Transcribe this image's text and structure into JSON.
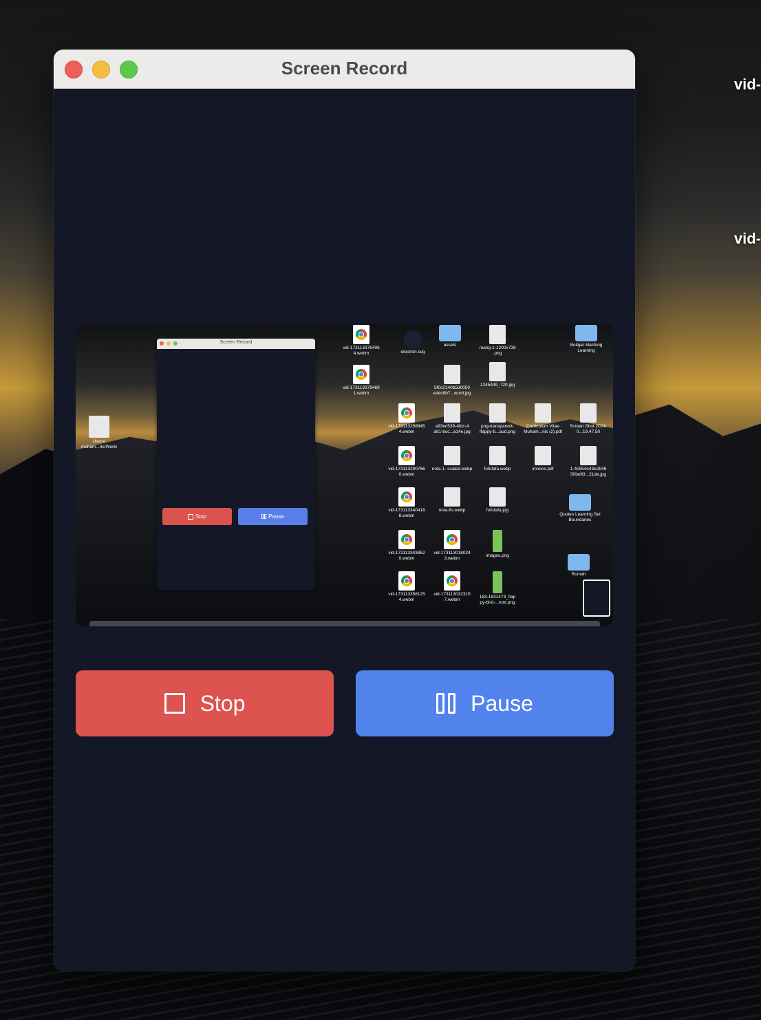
{
  "desktop": {
    "labels": [
      "vid-",
      "vid-"
    ]
  },
  "window": {
    "title": "Screen Record",
    "traffic_lights": [
      "close",
      "minimize",
      "zoom"
    ]
  },
  "preview": {
    "mini_window_title": "Screen Record",
    "mini_stop_label": "Stop",
    "mini_pause_label": "Pause",
    "left_item_label": "Users/ muham...rls/Work/",
    "icons": [
      {
        "label": "vid-173113376406 4.webm",
        "kind": "chrome"
      },
      {
        "label": "electron.svg",
        "kind": "svg"
      },
      {
        "label": "assets",
        "kind": "folder"
      },
      {
        "label": "ruang-1-1200x738 .png",
        "kind": "img"
      },
      {
        "label": "Belajar Maching Learning",
        "kind": "folder"
      },
      {
        "label": "vid-173113379469 1.webm",
        "kind": "chrome"
      },
      {
        "label": "5f0c2140b5d0050 edec8b7...word.jpg",
        "kind": "img"
      },
      {
        "label": "1245449_720.jpg",
        "kind": "img"
      },
      {
        "label": "vid-173113258845 4.webm",
        "kind": "chrome"
      },
      {
        "label": "a93ec539-4fdc-4 a81-bcc...a14e.jpg",
        "kind": "img"
      },
      {
        "label": "png-transparent- flappy-b...aud.png",
        "kind": "img"
      },
      {
        "label": "Curriculum Vitae Muham...nis (2).pdf",
        "kind": "img"
      },
      {
        "label": "Screen Shot 2024-0...19.47.50",
        "kind": "img"
      },
      {
        "label": "vid-173113290766 0.webm",
        "kind": "chrome"
      },
      {
        "label": "nota-1- scaled.webp",
        "kind": "img"
      },
      {
        "label": "fufufafa.webp",
        "kind": "img"
      },
      {
        "label": "invoice.pdf",
        "kind": "img"
      },
      {
        "label": "1-4c954e43e2b46 50be93...21de.jpg",
        "kind": "img"
      },
      {
        "label": "vid-173113340418 8.webm",
        "kind": "chrome"
      },
      {
        "label": "nota-fis.webp",
        "kind": "img"
      },
      {
        "label": "fufufafa.jpg",
        "kind": "img"
      },
      {
        "label": "Quotes Learning Set Boundaries",
        "kind": "folder"
      },
      {
        "label": "vid-173113343852 0.webm",
        "kind": "chrome"
      },
      {
        "label": "vid-173113018024 3.webm",
        "kind": "chrome"
      },
      {
        "label": "images.png",
        "kind": "green"
      },
      {
        "label": "Rumah",
        "kind": "folder"
      },
      {
        "label": "vid-173113358125 4.webm",
        "kind": "chrome"
      },
      {
        "label": "vid-173113032315 7.webm",
        "kind": "chrome"
      },
      {
        "label": "183-1831473_flap py-bird-...ront.png",
        "kind": "green"
      }
    ]
  },
  "controls": {
    "stop_label": "Stop",
    "pause_label": "Pause"
  },
  "colors": {
    "stop": "#dc534f",
    "pause": "#5282ec",
    "window_bg": "#141826"
  }
}
